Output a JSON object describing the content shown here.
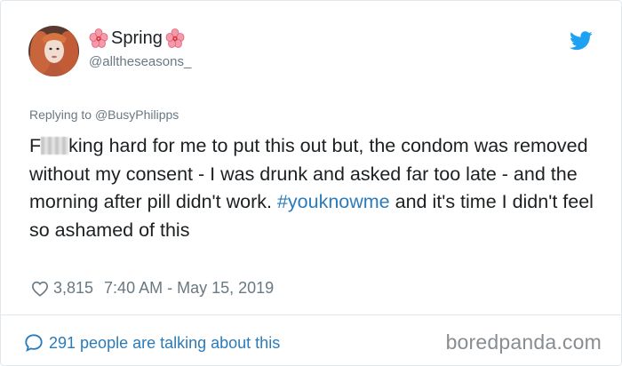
{
  "author": {
    "display_name": "Spring",
    "handle": "@alltheseasons_",
    "name_decoration_icon": "hibiscus-flower-emoji"
  },
  "platform_icon": "twitter-bird-icon",
  "reply_to": {
    "prefix": "Replying to ",
    "user": "@BusyPhilipps"
  },
  "tweet": {
    "censored_start": "F",
    "censored_end": "king",
    "text_after_censor": " hard for me to put this out but, the condom was removed without my consent - I was drunk and asked far too late - and the morning after pill didn't work. ",
    "hashtag": "#youknowme",
    "text_after_hashtag": " and it's time I didn't feel so ashamed of this"
  },
  "meta": {
    "likes": "3,815",
    "timestamp": "7:40 AM - May 15, 2019"
  },
  "footer": {
    "talking": "291 people are talking about this"
  },
  "watermark": "boredpanda.com",
  "colors": {
    "link": "#2b7bb9",
    "muted": "#697882",
    "text": "#1c2022",
    "twitter_blue": "#1da1f2"
  }
}
